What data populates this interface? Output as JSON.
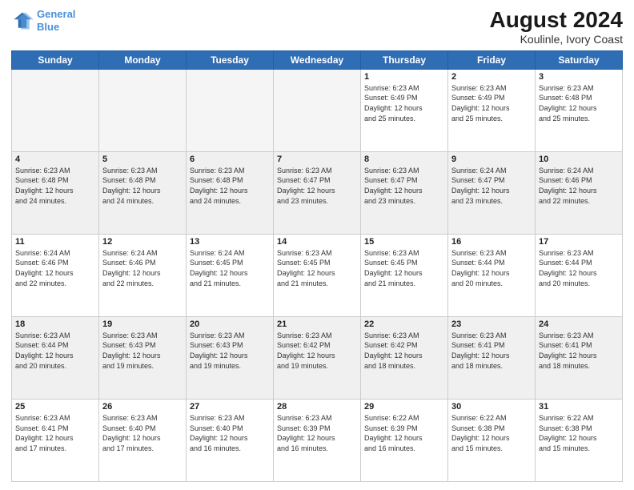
{
  "header": {
    "logo_line1": "General",
    "logo_line2": "Blue",
    "title": "August 2024",
    "subtitle": "Koulinle, Ivory Coast"
  },
  "days_of_week": [
    "Sunday",
    "Monday",
    "Tuesday",
    "Wednesday",
    "Thursday",
    "Friday",
    "Saturday"
  ],
  "weeks": [
    [
      {
        "day": "",
        "info": "",
        "empty": true
      },
      {
        "day": "",
        "info": "",
        "empty": true
      },
      {
        "day": "",
        "info": "",
        "empty": true
      },
      {
        "day": "",
        "info": "",
        "empty": true
      },
      {
        "day": "1",
        "info": "Sunrise: 6:23 AM\nSunset: 6:49 PM\nDaylight: 12 hours\nand 25 minutes.",
        "empty": false
      },
      {
        "day": "2",
        "info": "Sunrise: 6:23 AM\nSunset: 6:49 PM\nDaylight: 12 hours\nand 25 minutes.",
        "empty": false
      },
      {
        "day": "3",
        "info": "Sunrise: 6:23 AM\nSunset: 6:48 PM\nDaylight: 12 hours\nand 25 minutes.",
        "empty": false
      }
    ],
    [
      {
        "day": "4",
        "info": "Sunrise: 6:23 AM\nSunset: 6:48 PM\nDaylight: 12 hours\nand 24 minutes.",
        "empty": false
      },
      {
        "day": "5",
        "info": "Sunrise: 6:23 AM\nSunset: 6:48 PM\nDaylight: 12 hours\nand 24 minutes.",
        "empty": false
      },
      {
        "day": "6",
        "info": "Sunrise: 6:23 AM\nSunset: 6:48 PM\nDaylight: 12 hours\nand 24 minutes.",
        "empty": false
      },
      {
        "day": "7",
        "info": "Sunrise: 6:23 AM\nSunset: 6:47 PM\nDaylight: 12 hours\nand 23 minutes.",
        "empty": false
      },
      {
        "day": "8",
        "info": "Sunrise: 6:23 AM\nSunset: 6:47 PM\nDaylight: 12 hours\nand 23 minutes.",
        "empty": false
      },
      {
        "day": "9",
        "info": "Sunrise: 6:24 AM\nSunset: 6:47 PM\nDaylight: 12 hours\nand 23 minutes.",
        "empty": false
      },
      {
        "day": "10",
        "info": "Sunrise: 6:24 AM\nSunset: 6:46 PM\nDaylight: 12 hours\nand 22 minutes.",
        "empty": false
      }
    ],
    [
      {
        "day": "11",
        "info": "Sunrise: 6:24 AM\nSunset: 6:46 PM\nDaylight: 12 hours\nand 22 minutes.",
        "empty": false
      },
      {
        "day": "12",
        "info": "Sunrise: 6:24 AM\nSunset: 6:46 PM\nDaylight: 12 hours\nand 22 minutes.",
        "empty": false
      },
      {
        "day": "13",
        "info": "Sunrise: 6:24 AM\nSunset: 6:45 PM\nDaylight: 12 hours\nand 21 minutes.",
        "empty": false
      },
      {
        "day": "14",
        "info": "Sunrise: 6:23 AM\nSunset: 6:45 PM\nDaylight: 12 hours\nand 21 minutes.",
        "empty": false
      },
      {
        "day": "15",
        "info": "Sunrise: 6:23 AM\nSunset: 6:45 PM\nDaylight: 12 hours\nand 21 minutes.",
        "empty": false
      },
      {
        "day": "16",
        "info": "Sunrise: 6:23 AM\nSunset: 6:44 PM\nDaylight: 12 hours\nand 20 minutes.",
        "empty": false
      },
      {
        "day": "17",
        "info": "Sunrise: 6:23 AM\nSunset: 6:44 PM\nDaylight: 12 hours\nand 20 minutes.",
        "empty": false
      }
    ],
    [
      {
        "day": "18",
        "info": "Sunrise: 6:23 AM\nSunset: 6:44 PM\nDaylight: 12 hours\nand 20 minutes.",
        "empty": false
      },
      {
        "day": "19",
        "info": "Sunrise: 6:23 AM\nSunset: 6:43 PM\nDaylight: 12 hours\nand 19 minutes.",
        "empty": false
      },
      {
        "day": "20",
        "info": "Sunrise: 6:23 AM\nSunset: 6:43 PM\nDaylight: 12 hours\nand 19 minutes.",
        "empty": false
      },
      {
        "day": "21",
        "info": "Sunrise: 6:23 AM\nSunset: 6:42 PM\nDaylight: 12 hours\nand 19 minutes.",
        "empty": false
      },
      {
        "day": "22",
        "info": "Sunrise: 6:23 AM\nSunset: 6:42 PM\nDaylight: 12 hours\nand 18 minutes.",
        "empty": false
      },
      {
        "day": "23",
        "info": "Sunrise: 6:23 AM\nSunset: 6:41 PM\nDaylight: 12 hours\nand 18 minutes.",
        "empty": false
      },
      {
        "day": "24",
        "info": "Sunrise: 6:23 AM\nSunset: 6:41 PM\nDaylight: 12 hours\nand 18 minutes.",
        "empty": false
      }
    ],
    [
      {
        "day": "25",
        "info": "Sunrise: 6:23 AM\nSunset: 6:41 PM\nDaylight: 12 hours\nand 17 minutes.",
        "empty": false
      },
      {
        "day": "26",
        "info": "Sunrise: 6:23 AM\nSunset: 6:40 PM\nDaylight: 12 hours\nand 17 minutes.",
        "empty": false
      },
      {
        "day": "27",
        "info": "Sunrise: 6:23 AM\nSunset: 6:40 PM\nDaylight: 12 hours\nand 16 minutes.",
        "empty": false
      },
      {
        "day": "28",
        "info": "Sunrise: 6:23 AM\nSunset: 6:39 PM\nDaylight: 12 hours\nand 16 minutes.",
        "empty": false
      },
      {
        "day": "29",
        "info": "Sunrise: 6:22 AM\nSunset: 6:39 PM\nDaylight: 12 hours\nand 16 minutes.",
        "empty": false
      },
      {
        "day": "30",
        "info": "Sunrise: 6:22 AM\nSunset: 6:38 PM\nDaylight: 12 hours\nand 15 minutes.",
        "empty": false
      },
      {
        "day": "31",
        "info": "Sunrise: 6:22 AM\nSunset: 6:38 PM\nDaylight: 12 hours\nand 15 minutes.",
        "empty": false
      }
    ]
  ]
}
